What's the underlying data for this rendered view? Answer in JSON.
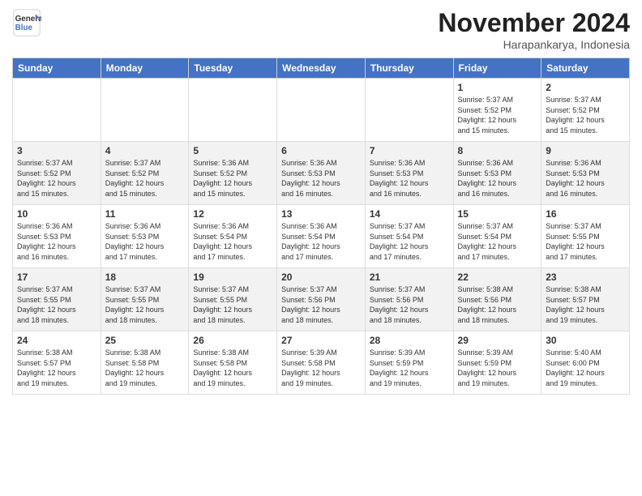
{
  "logo": {
    "line1": "General",
    "line2": "Blue"
  },
  "header": {
    "month": "November 2024",
    "location": "Harapankarya, Indonesia"
  },
  "days_of_week": [
    "Sunday",
    "Monday",
    "Tuesday",
    "Wednesday",
    "Thursday",
    "Friday",
    "Saturday"
  ],
  "weeks": [
    [
      {
        "day": "",
        "info": ""
      },
      {
        "day": "",
        "info": ""
      },
      {
        "day": "",
        "info": ""
      },
      {
        "day": "",
        "info": ""
      },
      {
        "day": "",
        "info": ""
      },
      {
        "day": "1",
        "info": "Sunrise: 5:37 AM\nSunset: 5:52 PM\nDaylight: 12 hours\nand 15 minutes."
      },
      {
        "day": "2",
        "info": "Sunrise: 5:37 AM\nSunset: 5:52 PM\nDaylight: 12 hours\nand 15 minutes."
      }
    ],
    [
      {
        "day": "3",
        "info": "Sunrise: 5:37 AM\nSunset: 5:52 PM\nDaylight: 12 hours\nand 15 minutes."
      },
      {
        "day": "4",
        "info": "Sunrise: 5:37 AM\nSunset: 5:52 PM\nDaylight: 12 hours\nand 15 minutes."
      },
      {
        "day": "5",
        "info": "Sunrise: 5:36 AM\nSunset: 5:52 PM\nDaylight: 12 hours\nand 15 minutes."
      },
      {
        "day": "6",
        "info": "Sunrise: 5:36 AM\nSunset: 5:53 PM\nDaylight: 12 hours\nand 16 minutes."
      },
      {
        "day": "7",
        "info": "Sunrise: 5:36 AM\nSunset: 5:53 PM\nDaylight: 12 hours\nand 16 minutes."
      },
      {
        "day": "8",
        "info": "Sunrise: 5:36 AM\nSunset: 5:53 PM\nDaylight: 12 hours\nand 16 minutes."
      },
      {
        "day": "9",
        "info": "Sunrise: 5:36 AM\nSunset: 5:53 PM\nDaylight: 12 hours\nand 16 minutes."
      }
    ],
    [
      {
        "day": "10",
        "info": "Sunrise: 5:36 AM\nSunset: 5:53 PM\nDaylight: 12 hours\nand 16 minutes."
      },
      {
        "day": "11",
        "info": "Sunrise: 5:36 AM\nSunset: 5:53 PM\nDaylight: 12 hours\nand 17 minutes."
      },
      {
        "day": "12",
        "info": "Sunrise: 5:36 AM\nSunset: 5:54 PM\nDaylight: 12 hours\nand 17 minutes."
      },
      {
        "day": "13",
        "info": "Sunrise: 5:36 AM\nSunset: 5:54 PM\nDaylight: 12 hours\nand 17 minutes."
      },
      {
        "day": "14",
        "info": "Sunrise: 5:37 AM\nSunset: 5:54 PM\nDaylight: 12 hours\nand 17 minutes."
      },
      {
        "day": "15",
        "info": "Sunrise: 5:37 AM\nSunset: 5:54 PM\nDaylight: 12 hours\nand 17 minutes."
      },
      {
        "day": "16",
        "info": "Sunrise: 5:37 AM\nSunset: 5:55 PM\nDaylight: 12 hours\nand 17 minutes."
      }
    ],
    [
      {
        "day": "17",
        "info": "Sunrise: 5:37 AM\nSunset: 5:55 PM\nDaylight: 12 hours\nand 18 minutes."
      },
      {
        "day": "18",
        "info": "Sunrise: 5:37 AM\nSunset: 5:55 PM\nDaylight: 12 hours\nand 18 minutes."
      },
      {
        "day": "19",
        "info": "Sunrise: 5:37 AM\nSunset: 5:55 PM\nDaylight: 12 hours\nand 18 minutes."
      },
      {
        "day": "20",
        "info": "Sunrise: 5:37 AM\nSunset: 5:56 PM\nDaylight: 12 hours\nand 18 minutes."
      },
      {
        "day": "21",
        "info": "Sunrise: 5:37 AM\nSunset: 5:56 PM\nDaylight: 12 hours\nand 18 minutes."
      },
      {
        "day": "22",
        "info": "Sunrise: 5:38 AM\nSunset: 5:56 PM\nDaylight: 12 hours\nand 18 minutes."
      },
      {
        "day": "23",
        "info": "Sunrise: 5:38 AM\nSunset: 5:57 PM\nDaylight: 12 hours\nand 19 minutes."
      }
    ],
    [
      {
        "day": "24",
        "info": "Sunrise: 5:38 AM\nSunset: 5:57 PM\nDaylight: 12 hours\nand 19 minutes."
      },
      {
        "day": "25",
        "info": "Sunrise: 5:38 AM\nSunset: 5:58 PM\nDaylight: 12 hours\nand 19 minutes."
      },
      {
        "day": "26",
        "info": "Sunrise: 5:38 AM\nSunset: 5:58 PM\nDaylight: 12 hours\nand 19 minutes."
      },
      {
        "day": "27",
        "info": "Sunrise: 5:39 AM\nSunset: 5:58 PM\nDaylight: 12 hours\nand 19 minutes."
      },
      {
        "day": "28",
        "info": "Sunrise: 5:39 AM\nSunset: 5:59 PM\nDaylight: 12 hours\nand 19 minutes."
      },
      {
        "day": "29",
        "info": "Sunrise: 5:39 AM\nSunset: 5:59 PM\nDaylight: 12 hours\nand 19 minutes."
      },
      {
        "day": "30",
        "info": "Sunrise: 5:40 AM\nSunset: 6:00 PM\nDaylight: 12 hours\nand 19 minutes."
      }
    ]
  ]
}
